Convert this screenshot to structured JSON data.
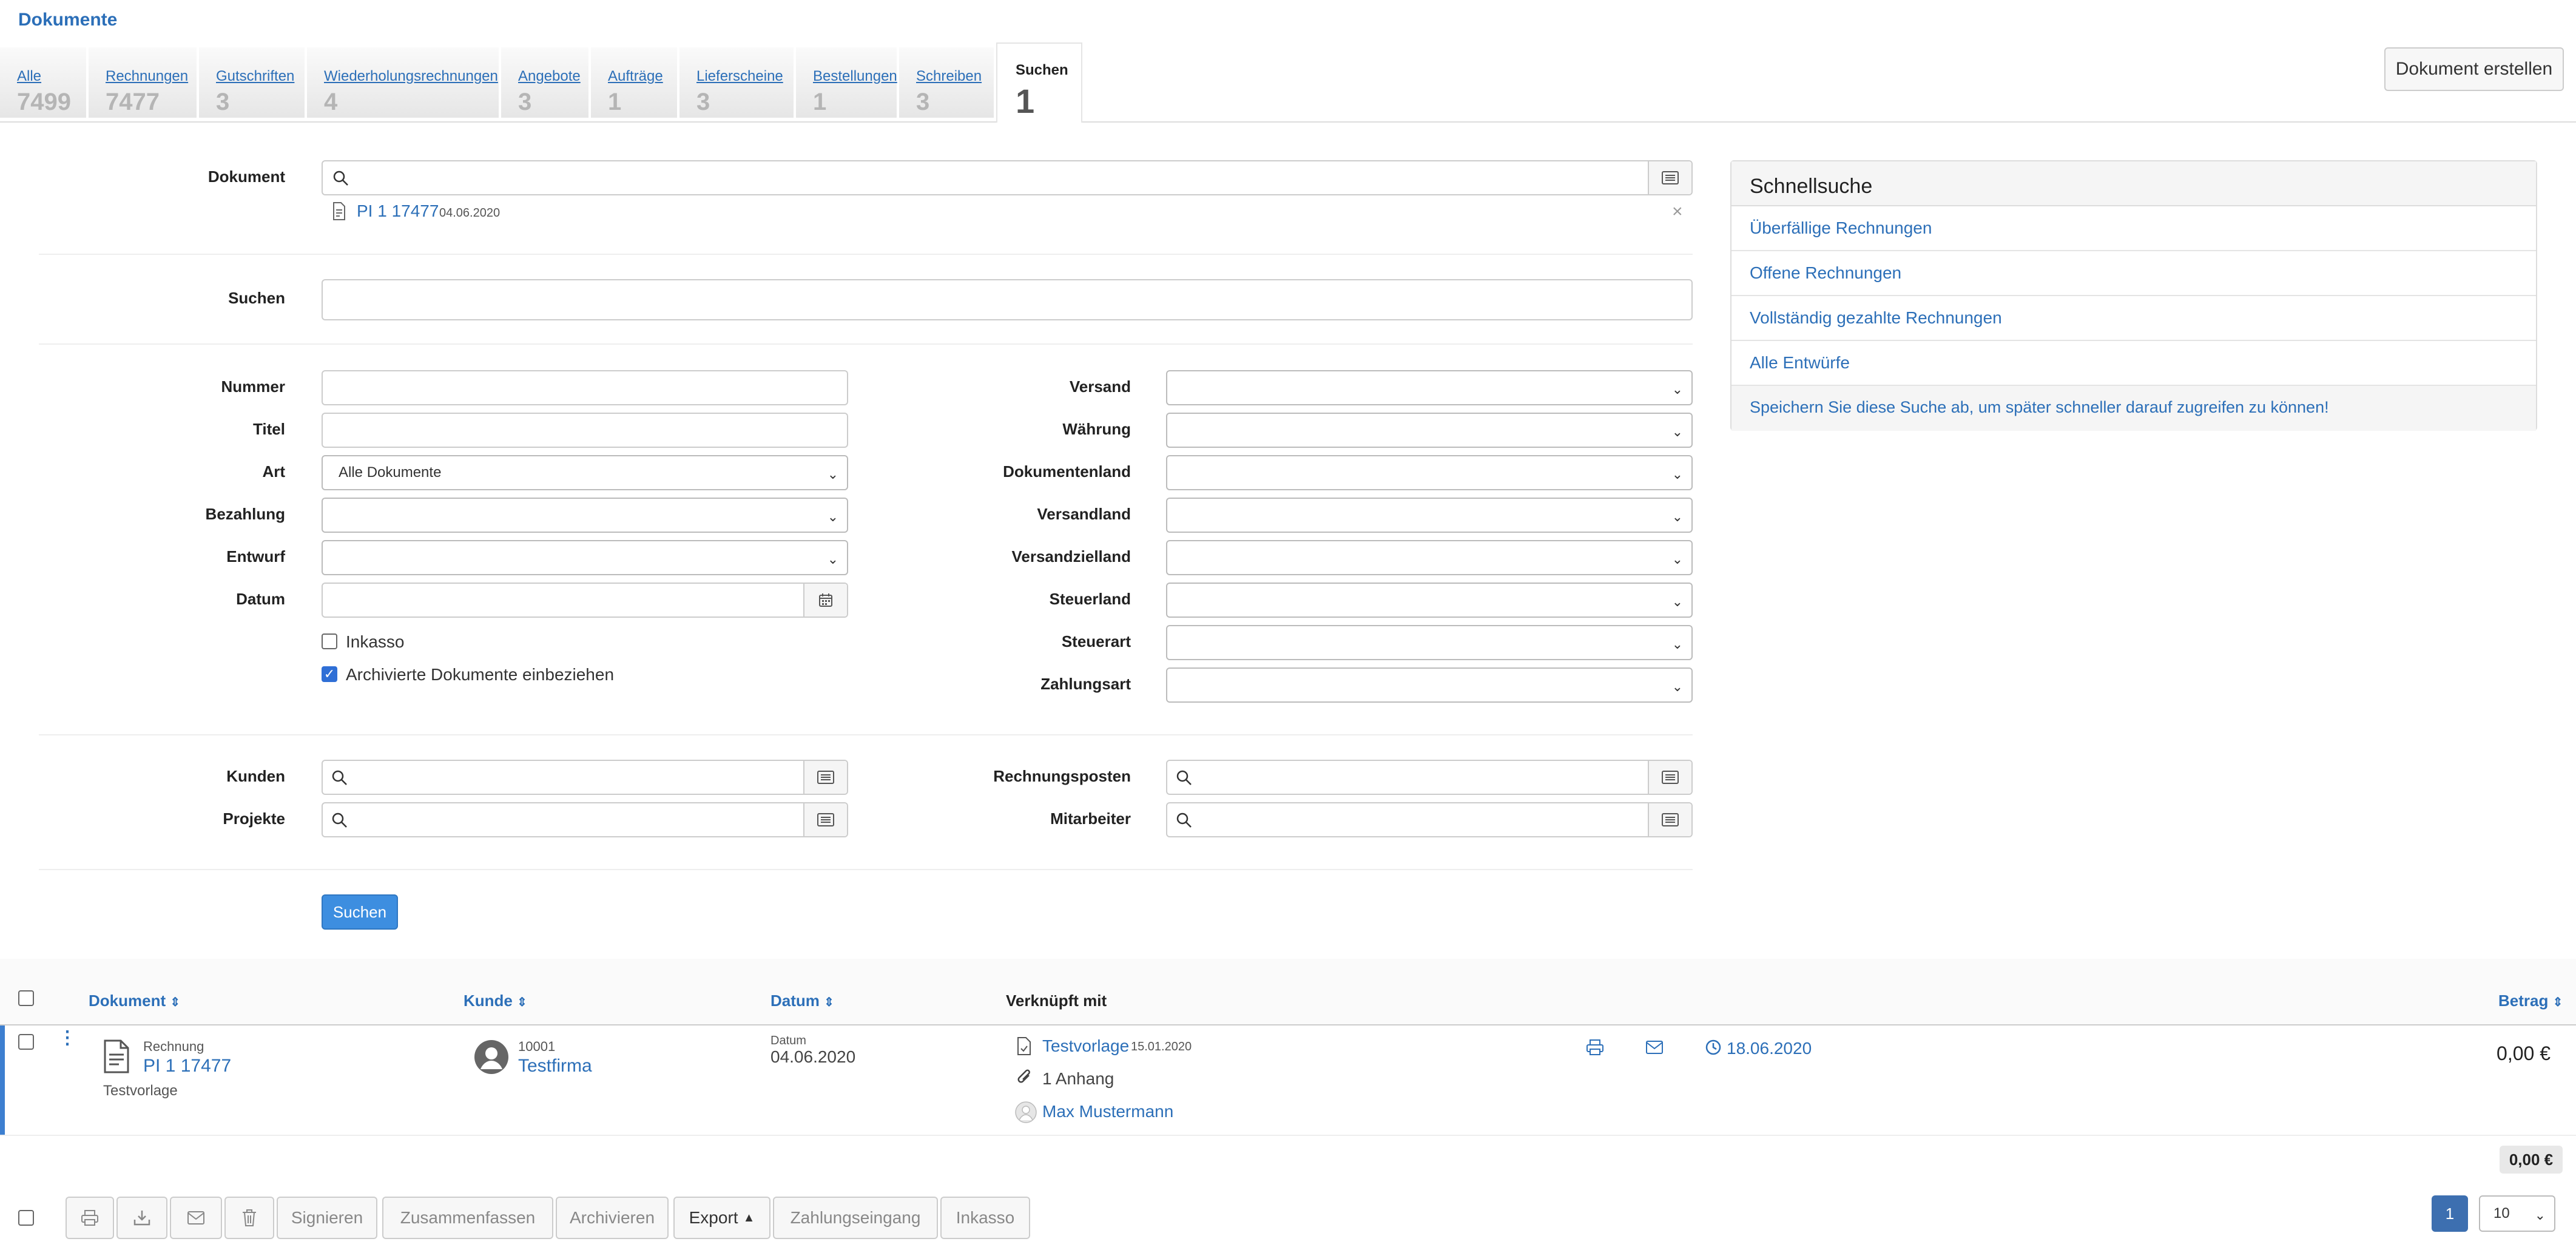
{
  "header": {
    "title": "Dokumente",
    "create_button": "Dokument erstellen"
  },
  "tabs": [
    {
      "label": "Alle",
      "count": "7499"
    },
    {
      "label": "Rechnungen",
      "count": "7477"
    },
    {
      "label": "Gutschriften",
      "count": "3"
    },
    {
      "label": "Wiederholungsrechnungen",
      "count": "4"
    },
    {
      "label": "Angebote",
      "count": "3"
    },
    {
      "label": "Aufträge",
      "count": "1"
    },
    {
      "label": "Lieferscheine",
      "count": "3"
    },
    {
      "label": "Bestellungen",
      "count": "1"
    },
    {
      "label": "Schreiben",
      "count": "3"
    },
    {
      "label": "Suchen",
      "count": "1"
    }
  ],
  "form": {
    "dokument_label": "Dokument",
    "selected_doc": {
      "number": "PI 1 17477",
      "date": "04.06.2020"
    },
    "suchen_label": "Suchen",
    "left_fields": {
      "nummer": "Nummer",
      "titel": "Titel",
      "art": "Art",
      "art_value": "Alle Dokumente",
      "bezahlung": "Bezahlung",
      "entwurf": "Entwurf",
      "datum": "Datum"
    },
    "checkboxes": {
      "inkasso": "Inkasso",
      "archiviert": "Archivierte Dokumente einbeziehen"
    },
    "right_fields": {
      "versand": "Versand",
      "waehrung": "Währung",
      "dokumentenland": "Dokumentenland",
      "versandland": "Versandland",
      "versandzielland": "Versandzielland",
      "steuerland": "Steuerland",
      "steuerart": "Steuerart",
      "zahlungsart": "Zahlungsart"
    },
    "kunden": "Kunden",
    "projekte": "Projekte",
    "rechnungsposten": "Rechnungsposten",
    "mitarbeiter": "Mitarbeiter",
    "submit": "Suchen"
  },
  "quick_search": {
    "title": "Schnellsuche",
    "items": [
      "Überfällige Rechnungen",
      "Offene Rechnungen",
      "Vollständig gezahlte Rechnungen",
      "Alle Entwürfe"
    ],
    "save_hint": "Speichern Sie diese Suche ab, um später schneller darauf zugreifen zu können!"
  },
  "table": {
    "headers": {
      "dokument": "Dokument",
      "kunde": "Kunde",
      "datum": "Datum",
      "verknuepft": "Verknüpft mit",
      "betrag": "Betrag"
    },
    "rows": [
      {
        "type": "Rechnung",
        "number": "PI 1 17477",
        "template": "Testvorlage",
        "customer_no": "10001",
        "customer": "Testfirma",
        "date_label": "Datum",
        "date": "04.06.2020",
        "linked_template": "Testvorlage",
        "linked_template_date": "15.01.2020",
        "attachments": "1 Anhang",
        "employee": "Max Mustermann",
        "due_date": "18.06.2020",
        "amount": "0,00 €"
      }
    ],
    "total": "0,00 €"
  },
  "footer": {
    "buttons": [
      "Signieren",
      "Zusammenfassen",
      "Archivieren",
      "Export",
      "Zahlungseingang",
      "Inkasso"
    ],
    "page": "1",
    "per_page": "10"
  }
}
